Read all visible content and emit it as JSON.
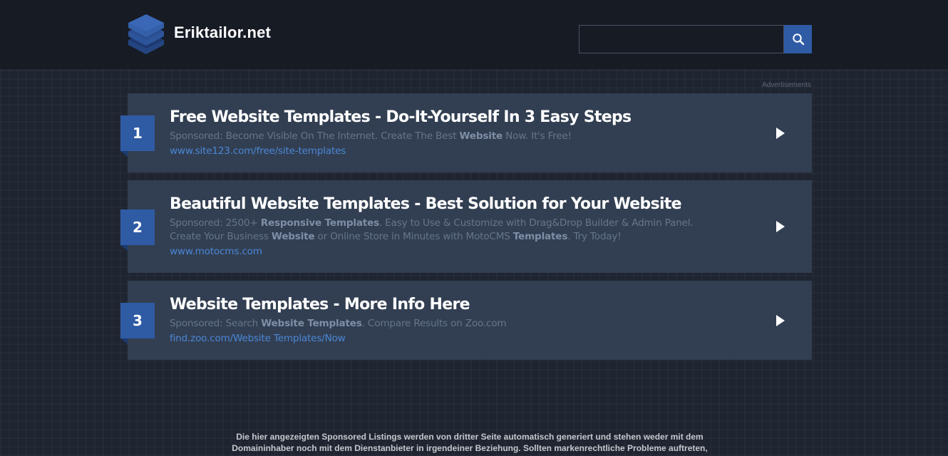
{
  "header": {
    "site_name": "Eriktailor.net",
    "logo_icon": "stacked-layers-icon",
    "search": {
      "value": "",
      "placeholder": "",
      "button_icon": "search-icon"
    }
  },
  "ads_label": "Advertisements",
  "ads": [
    {
      "number": "1",
      "title": "Free Website Templates - Do-It-Yourself In 3 Easy Steps",
      "description": [
        {
          "text": "Sponsored: Become Visible On The Internet. Create The Best ",
          "bold": false
        },
        {
          "text": "Website",
          "bold": true
        },
        {
          "text": " Now. It's Free!",
          "bold": false
        }
      ],
      "url": "www.site123.com/free/site-templates"
    },
    {
      "number": "2",
      "title": "Beautiful Website Templates - Best Solution for Your Website",
      "description": [
        {
          "text": "Sponsored: 2500+ ",
          "bold": false
        },
        {
          "text": "Responsive Templates",
          "bold": true
        },
        {
          "text": ". Easy to Use & Customize with Drag&Drop Builder & Admin Panel. Create Your Business ",
          "bold": false
        },
        {
          "text": "Website",
          "bold": true
        },
        {
          "text": " or Online Store in Minutes with MotoCMS ",
          "bold": false
        },
        {
          "text": "Templates",
          "bold": true
        },
        {
          "text": ". Try Today!",
          "bold": false
        }
      ],
      "url": "www.motocms.com"
    },
    {
      "number": "3",
      "title": "Website Templates - More Info Here",
      "description": [
        {
          "text": "Sponsored: Search ",
          "bold": false
        },
        {
          "text": "Website Templates",
          "bold": true
        },
        {
          "text": ". Compare Results on Zoo.com",
          "bold": false
        }
      ],
      "url": "find.zoo.com/Website Templates/Now"
    }
  ],
  "disclaimer": "Die hier angezeigten Sponsored Listings werden von dritter Seite automatisch generiert und stehen weder mit dem Domaininhaber noch mit dem Dienstanbieter in irgendeiner Beziehung. Sollten markenrechtliche Probleme auftreten,",
  "colors": {
    "header_bg": "#161b24",
    "page_bg": "#1f2530",
    "card_bg": "#323f52",
    "accent": "#2f5ba5",
    "link": "#4a86d6"
  }
}
